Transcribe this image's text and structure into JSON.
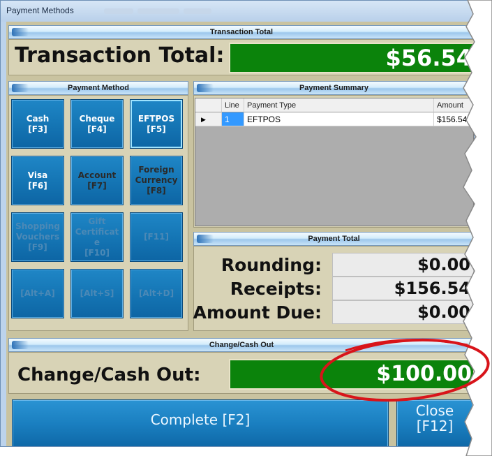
{
  "window": {
    "title": "Payment Methods"
  },
  "transaction": {
    "header": "Transaction Total",
    "label": "Transaction Total:",
    "value": "$56.54"
  },
  "payment_method": {
    "header": "Payment Method",
    "buttons": [
      {
        "label": "Cash\n[F3]"
      },
      {
        "label": "Cheque\n[F4]"
      },
      {
        "label": "EFTPOS\n[F5]"
      },
      {
        "label": "Visa\n[F6]"
      },
      {
        "label": "Account\n[F7]"
      },
      {
        "label": "Foreign\nCurrency\n[F8]"
      },
      {
        "label": "Shopping\nVouchers\n[F9]"
      },
      {
        "label": "Gift\nCertificat\ne\n[F10]"
      },
      {
        "label": "[F11]"
      },
      {
        "label": "[Alt+A]"
      },
      {
        "label": "[Alt+S]"
      },
      {
        "label": "[Alt+D]"
      }
    ]
  },
  "payment_summary": {
    "header": "Payment Summary",
    "columns": [
      "Line",
      "Payment Type",
      "Amount"
    ],
    "rows": [
      {
        "line": "1",
        "type": "EFTPOS",
        "amount": "$156.54"
      }
    ]
  },
  "payment_total": {
    "header": "Payment Total",
    "rounding_label": "Rounding:",
    "rounding_value": "$0.00",
    "receipts_label": "Receipts:",
    "receipts_value": "$156.54",
    "due_label": "Amount Due:",
    "due_value": "$0.00"
  },
  "change": {
    "header": "Change/Cash Out",
    "label": "Change/Cash Out:",
    "value": "$100.00"
  },
  "actions": {
    "complete": "Complete [F2]",
    "close": "Close\n[F12]"
  },
  "colors": {
    "green_display": "#0b830b",
    "button_blue": "#1576b5",
    "annotation_red": "#d8141a"
  }
}
